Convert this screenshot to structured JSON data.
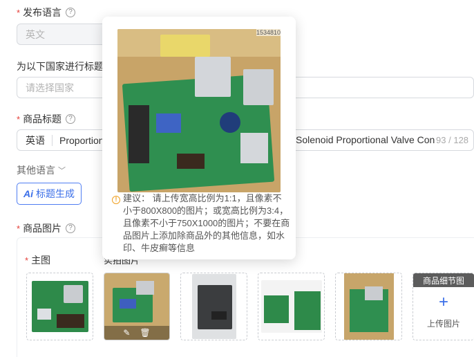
{
  "form": {
    "publish_language": {
      "label": "发布语言",
      "required_mark": "*",
      "value": "英文"
    },
    "title_country": {
      "label": "为以下国家进行标题",
      "placeholder": "请选择国家"
    },
    "product_title": {
      "label": "商品标题",
      "required_mark": "*",
      "lang": "英语",
      "text_left": "Proportion",
      "text_right": "Solenoid Proportional Valve Con",
      "count": "93",
      "separator": "/",
      "max": "128"
    },
    "other_lang": {
      "label": "其他语言"
    },
    "ai_button": {
      "icon_text": "Ai",
      "label": "标题生成"
    },
    "product_images": {
      "label": "商品图片",
      "required_mark": "*",
      "main_label": "主图",
      "partial_label": "实拍图片"
    },
    "upload_card": {
      "header": "商品细节图",
      "plus": "+",
      "label": "上传图片"
    }
  },
  "popover": {
    "tip_icon": "!",
    "tip_text": "建议： 请上传宽高比例为1:1，且像素不小于800X800的图片；或宽高比例为3:4，且像素不小于750X1000的图片；不要在商品图片上添加除商品外的其他信息，如水印、牛皮癣等信息",
    "watermark": "1534810"
  },
  "icons": {
    "help": "?",
    "chevron": "﹀",
    "edit": "✎",
    "trash": "🗑"
  },
  "colors": {
    "accent": "#3a6ee8",
    "required": "#e5413b",
    "warning": "#f0a020",
    "upload_header_bg": "#5c5c5c"
  }
}
